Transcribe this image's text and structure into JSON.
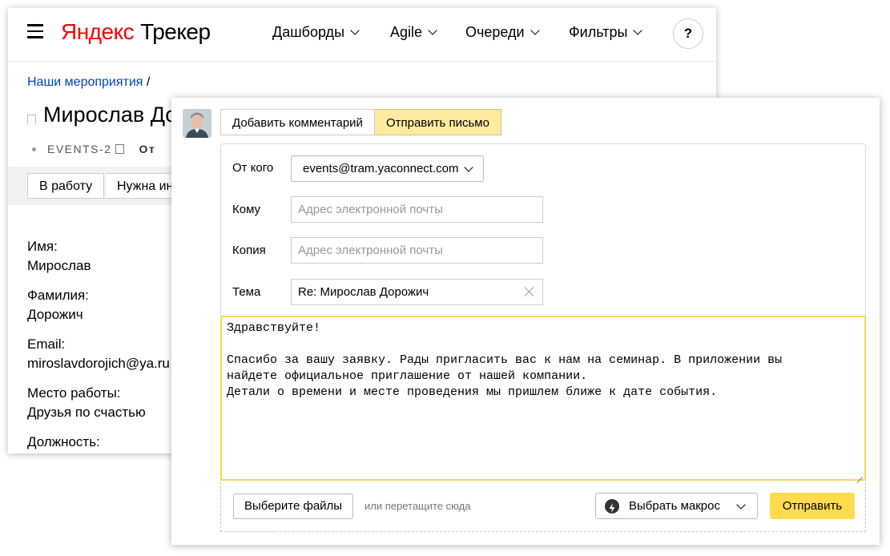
{
  "header": {
    "logo_brand": "Яндекс",
    "logo_product": "Трекер",
    "nav": [
      {
        "label": "Дашборды"
      },
      {
        "label": "Agile"
      },
      {
        "label": "Очереди"
      },
      {
        "label": "Фильтры"
      }
    ],
    "help_label": "?"
  },
  "issue": {
    "breadcrumb_link": "Наши мероприятия",
    "breadcrumb_sep": "/",
    "title": "Мирослав До",
    "key": "EVENTS-2",
    "status_partial": "От",
    "actions": [
      "В работу",
      "Нужна ин"
    ],
    "fields": [
      {
        "label": "Имя:",
        "value": "Мирослав"
      },
      {
        "label": "Фамилия:",
        "value": "Дорожич"
      },
      {
        "label": "Email:",
        "value": "miroslavdorojich@ya.ru"
      },
      {
        "label": "Место работы:",
        "value": "Друзья по счастью"
      },
      {
        "label": "Должность:",
        "value": ""
      }
    ]
  },
  "composer": {
    "tabs": [
      {
        "label": "Добавить комментарий",
        "active": false
      },
      {
        "label": "Отправить письмо",
        "active": true
      }
    ],
    "from_label": "От кого",
    "from_value": "events@tram.yaconnect.com",
    "to_label": "Кому",
    "to_placeholder": "Адрес электронной почты",
    "cc_label": "Копия",
    "cc_placeholder": "Адрес электронной почты",
    "subject_label": "Тема",
    "subject_value": "Re: Мирослав Дорожич",
    "body": "Здравствуйте!\n\nСпасибо за вашу заявку. Рады пригласить вас к нам на семинар. В приложении вы\nнайдете официальное приглашение от нашей компании.\nДетали о времени и месте проведения мы пришлем ближе к дате события.",
    "files_button": "Выберите файлы",
    "drop_hint": "или перетащите сюда",
    "macro_label": "Выбрать макрос",
    "send_label": "Отправить"
  },
  "colors": {
    "brand_red": "#ff0000",
    "link_blue": "#0044bb",
    "active_tab": "#ffeba0",
    "send_yellow": "#ffdb4d",
    "focus_border": "#ffd84d"
  }
}
